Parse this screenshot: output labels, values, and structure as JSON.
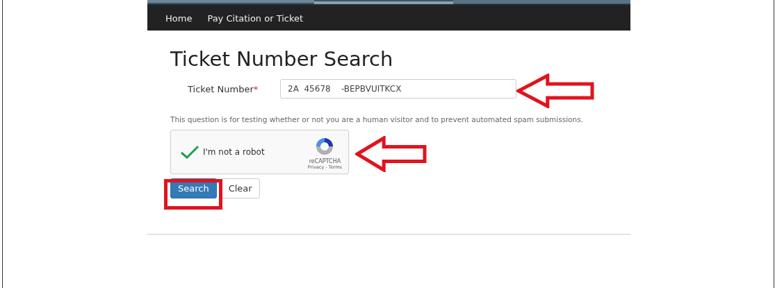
{
  "nav": {
    "items": [
      {
        "label": "Home"
      },
      {
        "label": "Pay Citation or Ticket"
      }
    ]
  },
  "page": {
    "title": "Ticket Number Search"
  },
  "form": {
    "ticket_label": "Ticket Number",
    "required_mark": "*",
    "ticket_value": "2A  45678    -BEPBVUITKCX",
    "help_text": "This question is for testing whether or not you are a human visitor and to prevent automated spam submissions.",
    "captcha": {
      "checked": true,
      "label": "I'm not a robot",
      "brand": "reCAPTCHA",
      "links": "Privacy - Terms"
    },
    "buttons": [
      {
        "kind": "primary",
        "label": "Search"
      },
      {
        "kind": "default",
        "label": "Clear"
      }
    ]
  },
  "annotations": [
    {
      "kind": "arrow"
    },
    {
      "kind": "arrow"
    },
    {
      "kind": "box"
    }
  ]
}
